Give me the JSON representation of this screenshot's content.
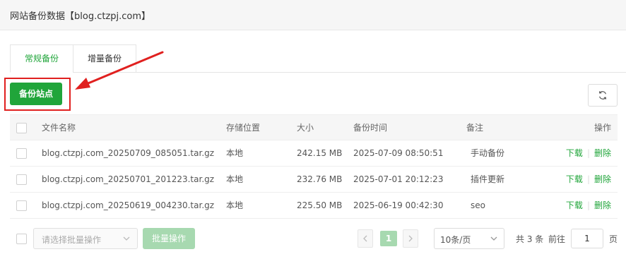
{
  "window": {
    "title": "网站备份数据【blog.ctzpj.com】"
  },
  "tabs": [
    {
      "label": "常规备份",
      "active": true
    },
    {
      "label": "增量备份",
      "active": false
    }
  ],
  "toolbar": {
    "backup_button": "备份站点",
    "refresh_icon": "refresh-icon"
  },
  "table": {
    "columns": [
      "文件名称",
      "存储位置",
      "大小",
      "备份时间",
      "备注",
      "操作"
    ],
    "rows": [
      {
        "name": "blog.ctzpj.com_20250709_085051.tar.gz",
        "location": "本地",
        "size": "242.15 MB",
        "time": "2025-07-09 08:50:51",
        "note": "手动备份",
        "download": "下载",
        "delete": "删除"
      },
      {
        "name": "blog.ctzpj.com_20250701_201223.tar.gz",
        "location": "本地",
        "size": "232.76 MB",
        "time": "2025-07-01 20:12:23",
        "note": "插件更新",
        "download": "下载",
        "delete": "删除"
      },
      {
        "name": "blog.ctzpj.com_20250619_004230.tar.gz",
        "location": "本地",
        "size": "225.50 MB",
        "time": "2025-06-19 00:42:30",
        "note": "seo",
        "download": "下载",
        "delete": "删除"
      }
    ]
  },
  "footer": {
    "batch_placeholder": "请选择批量操作",
    "batch_button": "批量操作",
    "current_page": "1",
    "per_page": "10条/页",
    "total": "共 3 条",
    "goto_label": "前往",
    "goto_value": "1",
    "goto_suffix": "页"
  },
  "colors": {
    "accent": "#20a53a",
    "accent_disabled": "#a7d9b0",
    "annotation": "#e0201f"
  }
}
